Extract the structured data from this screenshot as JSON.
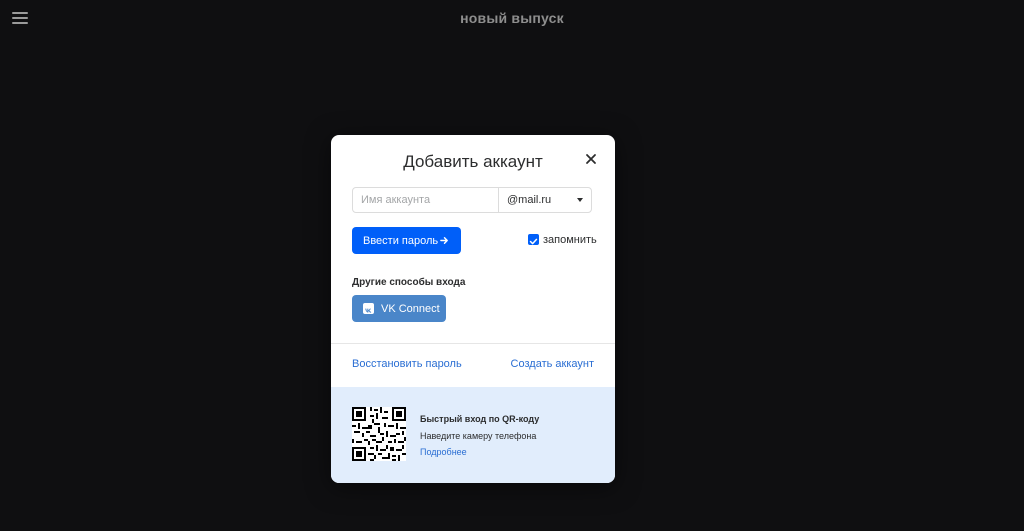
{
  "header": {
    "brand": "новый выпуск",
    "menu_icon": "hamburger-menu-icon"
  },
  "modal": {
    "title": "Добавить аккаунт",
    "close_icon": "close-icon",
    "login": {
      "value": "",
      "placeholder": "Имя аккаунта",
      "domain": "@mail.ru",
      "domain_caret_icon": "caret-down-icon"
    },
    "enter_password_button": "Ввести пароль",
    "enter_password_icon": "arrow-right-icon",
    "remember": {
      "label": "запомнить",
      "checked": true
    },
    "other_methods_title": "Другие способы входа",
    "vk_connect_button": "VK Connect",
    "vk_icon": "vk-logo-icon",
    "restore_password_link": "Восстановить пароль",
    "create_account_link": "Создать аккаунт",
    "qr": {
      "title": "Быстрый вход по QR-коду",
      "subtitle": "Наведите камеру телефона",
      "more_link": "Подробнее"
    }
  },
  "colors": {
    "background": "#0f0f11",
    "accent": "#005ff9",
    "vk": "#4a86c9",
    "link": "#2a6ed3",
    "qr_panel": "#e1edfc"
  }
}
